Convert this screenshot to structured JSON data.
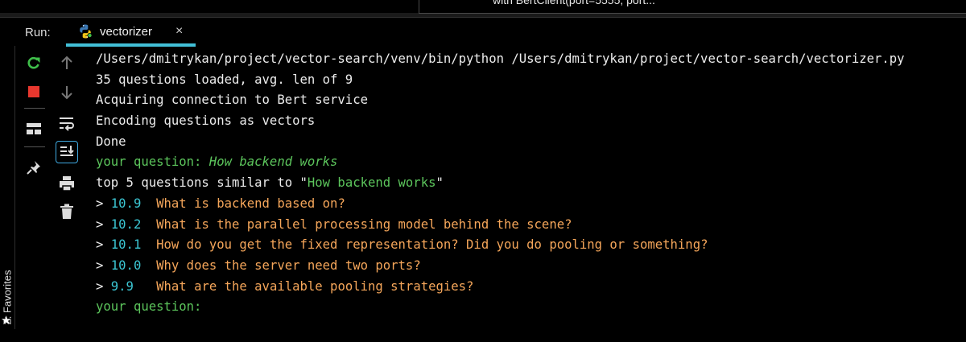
{
  "editor": {
    "tooltip": "with BertClient(port=5555, port..."
  },
  "run_panel": {
    "label": "Run:",
    "tab_name": "vectorizer",
    "tab_close": "×"
  },
  "favorites": {
    "label": "2: Favorites",
    "star": "★"
  },
  "toolbar_icons": [
    "rerun-icon",
    "stop-icon",
    "layout-icon",
    "pin-icon",
    "up-arrow-icon",
    "down-arrow-icon",
    "soft-wrap-icon",
    "scroll-to-end-icon",
    "print-icon",
    "trash-icon"
  ],
  "console": {
    "command": "/Users/dmitrykan/project/vector-search/venv/bin/python /Users/dmitrykan/project/vector-search/vectorizer.py",
    "loaded": "35 questions loaded, avg. len of 9",
    "acquiring": "Acquiring connection to Bert service",
    "encoding": "Encoding questions as vectors",
    "done": "Done",
    "prompt_label": "your question: ",
    "query": "How backend works",
    "top_prefix": "top 5 questions similar to \"",
    "top_query": "How backend works",
    "top_suffix": "\"",
    "results": [
      {
        "marker": "> ",
        "score": "10.9",
        "gap": "  ",
        "text": "What is backend based on?"
      },
      {
        "marker": "> ",
        "score": "10.2",
        "gap": "  ",
        "text": "What is the parallel processing model behind the scene?"
      },
      {
        "marker": "> ",
        "score": "10.1",
        "gap": "  ",
        "text": "How do you get the fixed representation? Did you do pooling or something?"
      },
      {
        "marker": "> ",
        "score": "10.0",
        "gap": "  ",
        "text": "Why does the server need two ports?"
      },
      {
        "marker": "> ",
        "score": "9.9",
        "gap": "   ",
        "text": "What are the available pooling strategies?"
      }
    ],
    "prompt_label_final": "your question:"
  },
  "colors": {
    "background": "#000000",
    "prompt_green": "#5cc55c",
    "score_cyan": "#3cc7d4",
    "result_orange": "#f5a65a",
    "tab_underline": "#42c0d8",
    "stop_red": "#e8372e",
    "rerun_green": "#3fbf4a"
  }
}
